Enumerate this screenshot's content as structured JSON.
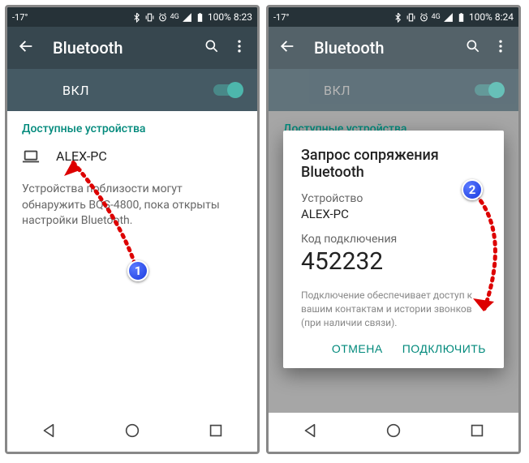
{
  "left": {
    "temp": "-17°",
    "battery": "100%",
    "time": "8:23",
    "net": "4G",
    "title": "Bluetooth",
    "toggle": "ВКЛ",
    "section": "Доступные устройства",
    "device": "ALEX-PC",
    "discover": "Устройства поблизости могут обнаружить BQS-4800, пока открыты настройки Bluetooth.",
    "badge": "1"
  },
  "right": {
    "temp": "-17°",
    "battery": "100%",
    "time": "8:24",
    "net": "4G",
    "title": "Bluetooth",
    "toggle": "ВКЛ",
    "section": "Доступные устройства",
    "dialog": {
      "title": "Запрос сопряжения Bluetooth",
      "devlabel": "Устройство",
      "devname": "ALEX-PC",
      "codelabel": "Код подключения",
      "code": "452232",
      "note": "Подключение обеспечивает доступ к вашим контактам и истории звонков (при наличии связи).",
      "cancel": "ОТМЕНА",
      "confirm": "ПОДКЛЮЧИТЬ"
    },
    "badge": "2"
  }
}
